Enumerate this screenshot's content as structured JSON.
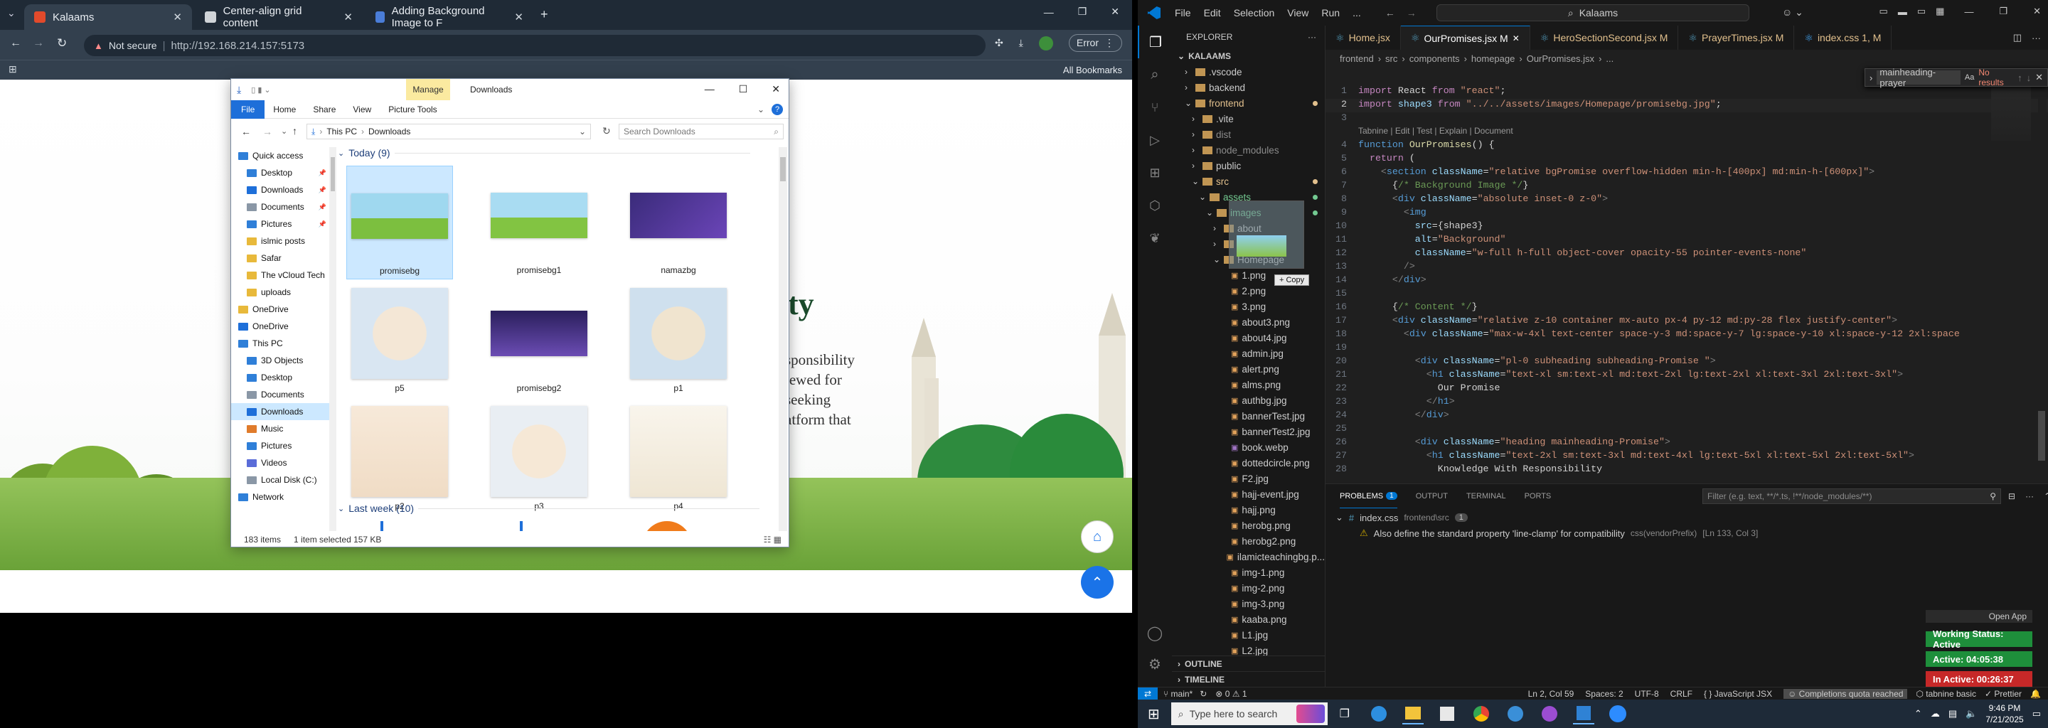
{
  "chrome": {
    "tabs": [
      {
        "title": "Kalaams",
        "active": true
      },
      {
        "title": "Center-align grid content",
        "active": false
      },
      {
        "title": "Adding Background Image to F",
        "active": false
      }
    ],
    "not_secure": "Not secure",
    "url": "http://192.168.214.157:5173",
    "profile": "Error",
    "all_bookmarks": "All Bookmarks",
    "page_fragments": [
      "ty",
      "sponsibility",
      "iewed for",
      "seeking",
      "atform that"
    ]
  },
  "explorer": {
    "title": "Downloads",
    "manage_tab": "Manage",
    "ribbon_tabs": [
      "File",
      "Home",
      "Share",
      "View",
      "Picture Tools"
    ],
    "breadcrumb": [
      "This PC",
      "Downloads"
    ],
    "search_placeholder": "Search Downloads",
    "sidebar": [
      {
        "label": "Quick access",
        "type": "group",
        "icon": "star-icon"
      },
      {
        "label": "Desktop",
        "type": "item",
        "icon": "folder-blue"
      },
      {
        "label": "Downloads",
        "type": "item",
        "icon": "download-icon"
      },
      {
        "label": "Documents",
        "type": "item",
        "icon": "folder-gray"
      },
      {
        "label": "Pictures",
        "type": "item",
        "icon": "folder-blue"
      },
      {
        "label": "islmic posts",
        "type": "item",
        "icon": "folder"
      },
      {
        "label": "Safar",
        "type": "item",
        "icon": "folder"
      },
      {
        "label": "The vCloud Tech",
        "type": "item",
        "icon": "folder"
      },
      {
        "label": "uploads",
        "type": "item",
        "icon": "folder"
      },
      {
        "label": "OneDrive",
        "type": "group",
        "icon": "folder"
      },
      {
        "label": "OneDrive",
        "type": "group",
        "icon": "cloud-icon"
      },
      {
        "label": "This PC",
        "type": "group",
        "icon": "pc-icon"
      },
      {
        "label": "3D Objects",
        "type": "item",
        "icon": "folder-blue"
      },
      {
        "label": "Desktop",
        "type": "item",
        "icon": "folder-blue"
      },
      {
        "label": "Documents",
        "type": "item",
        "icon": "folder-gray"
      },
      {
        "label": "Downloads",
        "type": "item",
        "icon": "download-icon",
        "selected": true
      },
      {
        "label": "Music",
        "type": "item",
        "icon": "music-icon"
      },
      {
        "label": "Pictures",
        "type": "item",
        "icon": "folder-blue"
      },
      {
        "label": "Videos",
        "type": "item",
        "icon": "video-icon"
      },
      {
        "label": "Local Disk (C:)",
        "type": "item",
        "icon": "disk-icon"
      },
      {
        "label": "Network",
        "type": "group",
        "icon": "network-icon"
      }
    ],
    "group_today": "Today (9)",
    "group_lastweek": "Last week (10)",
    "files": [
      {
        "name": "promisebg",
        "selected": true
      },
      {
        "name": "promisebg1"
      },
      {
        "name": "namazbg"
      },
      {
        "name": "p5"
      },
      {
        "name": "promisebg2"
      },
      {
        "name": "p1"
      },
      {
        "name": "p2"
      },
      {
        "name": "p3"
      },
      {
        "name": "p4"
      }
    ],
    "status_items": "183 items",
    "status_selected": "1 item selected  157 KB"
  },
  "vscode": {
    "menu": [
      "File",
      "Edit",
      "Selection",
      "View",
      "Run",
      "..."
    ],
    "search_title": "Kalaams",
    "explorer_label": "EXPLORER",
    "root": "KALAAMS",
    "tree": [
      {
        "name": ".vscode",
        "depth": 1,
        "kind": "folder"
      },
      {
        "name": "backend",
        "depth": 1,
        "kind": "folder"
      },
      {
        "name": "frontend",
        "depth": 1,
        "kind": "folder-open",
        "color": "#e2c08d",
        "dot": true
      },
      {
        "name": ".vite",
        "depth": 2,
        "kind": "folder"
      },
      {
        "name": "dist",
        "depth": 2,
        "kind": "folder",
        "color": "#8b8b8b"
      },
      {
        "name": "node_modules",
        "depth": 2,
        "kind": "folder",
        "color": "#8b8b8b"
      },
      {
        "name": "public",
        "depth": 2,
        "kind": "folder"
      },
      {
        "name": "src",
        "depth": 2,
        "kind": "folder-open",
        "color": "#e2c08d",
        "dot": true
      },
      {
        "name": "assets",
        "depth": 3,
        "kind": "folder-open",
        "color": "#73c991",
        "dot": true
      },
      {
        "name": "images",
        "depth": 4,
        "kind": "folder-open",
        "color": "#73c991",
        "dot": true
      },
      {
        "name": "about",
        "depth": 5,
        "kind": "folder"
      },
      {
        "name": "gallery",
        "depth": 5,
        "kind": "folder"
      },
      {
        "name": "Homepage",
        "depth": 5,
        "kind": "folder-open"
      },
      {
        "name": "1.png",
        "depth": 6,
        "kind": "png"
      },
      {
        "name": "2.png",
        "depth": 6,
        "kind": "png"
      },
      {
        "name": "3.png",
        "depth": 6,
        "kind": "png"
      },
      {
        "name": "about3.png",
        "depth": 6,
        "kind": "png"
      },
      {
        "name": "about4.jpg",
        "depth": 6,
        "kind": "png"
      },
      {
        "name": "admin.jpg",
        "depth": 6,
        "kind": "png"
      },
      {
        "name": "alert.png",
        "depth": 6,
        "kind": "png"
      },
      {
        "name": "alms.png",
        "depth": 6,
        "kind": "png"
      },
      {
        "name": "authbg.jpg",
        "depth": 6,
        "kind": "png"
      },
      {
        "name": "bannerTest.jpg",
        "depth": 6,
        "kind": "png"
      },
      {
        "name": "bannerTest2.jpg",
        "depth": 6,
        "kind": "png"
      },
      {
        "name": "book.webp",
        "depth": 6,
        "kind": "webp"
      },
      {
        "name": "dottedcircle.png",
        "depth": 6,
        "kind": "png"
      },
      {
        "name": "F2.jpg",
        "depth": 6,
        "kind": "png"
      },
      {
        "name": "hajj-event.jpg",
        "depth": 6,
        "kind": "png"
      },
      {
        "name": "hajj.png",
        "depth": 6,
        "kind": "png"
      },
      {
        "name": "herobg.png",
        "depth": 6,
        "kind": "png"
      },
      {
        "name": "herobg2.png",
        "depth": 6,
        "kind": "png"
      },
      {
        "name": "ilamicteachingbg.p...",
        "depth": 6,
        "kind": "png"
      },
      {
        "name": "img-1.png",
        "depth": 6,
        "kind": "png"
      },
      {
        "name": "img-2.png",
        "depth": 6,
        "kind": "png"
      },
      {
        "name": "img-3.png",
        "depth": 6,
        "kind": "png"
      },
      {
        "name": "kaaba.png",
        "depth": 6,
        "kind": "png"
      },
      {
        "name": "L1.jpg",
        "depth": 6,
        "kind": "png"
      },
      {
        "name": "L2.jpg",
        "depth": 6,
        "kind": "png"
      }
    ],
    "drag_copy": "+ Copy",
    "outline": "OUTLINE",
    "timeline": "TIMELINE",
    "tabs": [
      {
        "name": "Home.jsx",
        "active": false
      },
      {
        "name": "OurPromises.jsx M",
        "active": true
      },
      {
        "name": "HeroSectionSecond.jsx M",
        "active": false
      },
      {
        "name": "PrayerTimes.jsx M",
        "active": false
      },
      {
        "name": "index.css 1, M",
        "active": false
      }
    ],
    "breadcrumb": [
      "frontend",
      "src",
      "components",
      "homepage",
      "OurPromises.jsx",
      "..."
    ],
    "find_value": "mainheading-prayer",
    "find_result": "No results",
    "tabnine_lens": "Tabnine | Edit | Test | Explain | Document",
    "code": [
      [
        [
          "k",
          "import"
        ],
        [
          "p",
          " React "
        ],
        [
          "k",
          "from"
        ],
        [
          "s",
          " \"react\""
        ],
        [
          "p",
          ";"
        ]
      ],
      [
        [
          "k",
          "import"
        ],
        [
          "a",
          " shape3 "
        ],
        [
          "k",
          "from"
        ],
        [
          "s",
          " \"../../assets/images/Homepage/promisebg.jpg\""
        ],
        [
          "p",
          ";"
        ]
      ],
      [],
      [
        [
          "kb",
          "function"
        ],
        [
          "f",
          " OurPromises"
        ],
        [
          "p",
          "() {"
        ]
      ],
      [
        [
          "k",
          "  return"
        ],
        [
          "p",
          " ("
        ]
      ],
      [
        [
          "g",
          "    <"
        ],
        [
          "tag",
          "section"
        ],
        [
          "a",
          " className"
        ],
        [
          "p",
          "="
        ],
        [
          "s",
          "\"relative bgPromise overflow-hidden min-h-[400px] md:min-h-[600px]\""
        ],
        [
          "g",
          ">"
        ]
      ],
      [
        [
          "p",
          "      {"
        ],
        [
          "c",
          "/* Background Image */"
        ],
        [
          "p",
          "}"
        ]
      ],
      [
        [
          "g",
          "      <"
        ],
        [
          "tag",
          "div"
        ],
        [
          "a",
          " className"
        ],
        [
          "p",
          "="
        ],
        [
          "s",
          "\"absolute inset-0 z-0\""
        ],
        [
          "g",
          ">"
        ]
      ],
      [
        [
          "g",
          "        <"
        ],
        [
          "tag",
          "img"
        ]
      ],
      [
        [
          "a",
          "          src"
        ],
        [
          "p",
          "={shape3}"
        ]
      ],
      [
        [
          "a",
          "          alt"
        ],
        [
          "p",
          "="
        ],
        [
          "s",
          "\"Background\""
        ]
      ],
      [
        [
          "a",
          "          className"
        ],
        [
          "p",
          "="
        ],
        [
          "s",
          "\"w-full h-full object-cover opacity-55 pointer-events-none\""
        ]
      ],
      [
        [
          "g",
          "        />"
        ]
      ],
      [
        [
          "g",
          "      </"
        ],
        [
          "tag",
          "div"
        ],
        [
          "g",
          ">"
        ]
      ],
      [],
      [
        [
          "p",
          "      {"
        ],
        [
          "c",
          "/* Content */"
        ],
        [
          "p",
          "}"
        ]
      ],
      [
        [
          "g",
          "      <"
        ],
        [
          "tag",
          "div"
        ],
        [
          "a",
          " className"
        ],
        [
          "p",
          "="
        ],
        [
          "s",
          "\"relative z-10 container mx-auto px-4 py-12 md:py-28 flex justify-center\""
        ],
        [
          "g",
          ">"
        ]
      ],
      [
        [
          "g",
          "        <"
        ],
        [
          "tag",
          "div"
        ],
        [
          "a",
          " className"
        ],
        [
          "p",
          "="
        ],
        [
          "s",
          "\"max-w-4xl text-center space-y-3 md:space-y-7 lg:space-y-10 xl:space-y-12 2xl:space"
        ]
      ],
      [],
      [
        [
          "g",
          "          <"
        ],
        [
          "tag",
          "div"
        ],
        [
          "a",
          " className"
        ],
        [
          "p",
          "="
        ],
        [
          "s",
          "\"pl-0 subheading subheading-Promise \""
        ],
        [
          "g",
          ">"
        ]
      ],
      [
        [
          "g",
          "            <"
        ],
        [
          "tag",
          "h1"
        ],
        [
          "a",
          " className"
        ],
        [
          "p",
          "="
        ],
        [
          "s",
          "\"text-xl sm:text-xl md:text-2xl lg:text-2xl xl:text-3xl 2xl:text-3xl\""
        ],
        [
          "g",
          ">"
        ]
      ],
      [
        [
          "p",
          "              Our Promise"
        ]
      ],
      [
        [
          "g",
          "            </"
        ],
        [
          "tag",
          "h1"
        ],
        [
          "g",
          ">"
        ]
      ],
      [
        [
          "g",
          "          </"
        ],
        [
          "tag",
          "div"
        ],
        [
          "g",
          ">"
        ]
      ],
      [],
      [
        [
          "g",
          "          <"
        ],
        [
          "tag",
          "div"
        ],
        [
          "a",
          " className"
        ],
        [
          "p",
          "="
        ],
        [
          "s",
          "\"heading mainheading-Promise\""
        ],
        [
          "g",
          ">"
        ]
      ],
      [
        [
          "g",
          "            <"
        ],
        [
          "tag",
          "h1"
        ],
        [
          "a",
          " className"
        ],
        [
          "p",
          "="
        ],
        [
          "s",
          "\"text-2xl sm:text-3xl md:text-4xl lg:text-5xl xl:text-5xl 2xl:text-5xl\""
        ],
        [
          "g",
          ">"
        ]
      ],
      [
        [
          "p",
          "              Knowledge With Responsibility"
        ]
      ]
    ],
    "line_numbers": [
      "1",
      "2",
      "3",
      "4",
      "5",
      "6",
      "7",
      "8",
      "9",
      "10",
      "11",
      "12",
      "13",
      "14",
      "15",
      "16",
      "17",
      "18",
      "19",
      "20",
      "21",
      "22",
      "23",
      "24",
      "25",
      "26",
      "27",
      "28"
    ],
    "panel_tabs": [
      "PROBLEMS",
      "OUTPUT",
      "TERMINAL",
      "PORTS"
    ],
    "problems_count": "1",
    "filter_placeholder": "Filter (e.g. text, **/*.ts, !**/node_modules/**)",
    "problem_file": "index.css",
    "problem_path": "frontend\\src",
    "problem_file_count": "1",
    "problem_message": "Also define the standard property 'line-clamp' for compatibility",
    "problem_source": "css(vendorPrefix)",
    "problem_loc": "[Ln 133, Col 3]",
    "status": {
      "branch": "main*",
      "errors": "0",
      "warnings": "1",
      "position": "Ln 2, Col 59",
      "spaces": "Spaces: 2",
      "encoding": "UTF-8",
      "eol": "CRLF",
      "language": "JavaScript JSX",
      "completions": "Completions quota reached",
      "tabnine": "tabnine basic",
      "prettier": "Prettier"
    },
    "widget": {
      "open_app": "Open App",
      "working": "Working Status: Active",
      "active": "Active: 04:05:38",
      "inactive": "In Active: 00:26:37"
    }
  },
  "taskbar": {
    "search_placeholder": "Type here to search",
    "time": "9:46 PM",
    "date": "7/21/2025"
  },
  "colors": {
    "vscode_bg": "#1f1f1f",
    "vscode_accent": "#0078d4",
    "chrome_dark": "#1f2a36",
    "mosque_green": "#2e8b3e",
    "working_green": "#1e8f3b",
    "inactive_red": "#c62828"
  }
}
